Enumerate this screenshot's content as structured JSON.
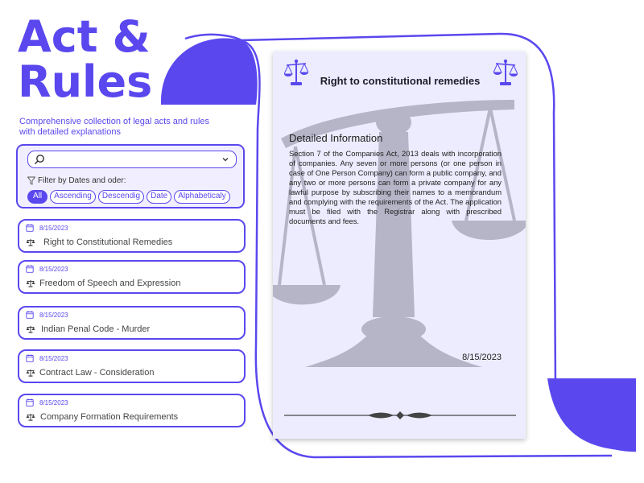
{
  "header": {
    "title_line1_word": "Act",
    "title_line1_amp": "&",
    "title_line2": "Rules",
    "subtitle": "Comprehensive collection of legal acts and rules with detailed explanations"
  },
  "search": {
    "value": "",
    "placeholder": ""
  },
  "filter": {
    "label": "Filter by Dates and oder:",
    "chips": [
      "All",
      "Ascending",
      "Descendig",
      "Date",
      "Alphabeticaly"
    ],
    "active": "All"
  },
  "items": [
    {
      "date": "8/15/2023",
      "name": "Right to Constitutional Remedies"
    },
    {
      "date": "8/15/2023",
      "name": "Freedom of Speech and Expression"
    },
    {
      "date": "8/15/2023",
      "name": "Indian Penal Code - Murder"
    },
    {
      "date": "8/15/2023",
      "name": "Contract Law - Consideration"
    },
    {
      "date": "8/15/2023",
      "name": "Company Formation Requirements"
    }
  ],
  "detail": {
    "title": "Right to constitutional remedies",
    "heading": "Detailed Information",
    "body": "Section 7 of the Companies Act, 2013 deals with incorporation of companies. Any seven or more persons (or one person in case of One Person Company) can form a public company, and any two or more persons can form a private company for any lawful purpose by subscribing their names to a memorandum and complying with the requirements of the Act. The application must be filed with the Registrar along with prescribed documents and fees.",
    "date": "8/15/2023"
  },
  "icons": {
    "search": "search-icon",
    "dropdown": "chevron-down-icon",
    "filter": "filter-icon",
    "calendar": "calendar-icon",
    "scale": "scale-icon"
  },
  "colors": {
    "accent": "#5a48ee",
    "card_bg": "#ececfe",
    "panel_bg": "#f1efff",
    "watermark": "#b3b2c4"
  }
}
